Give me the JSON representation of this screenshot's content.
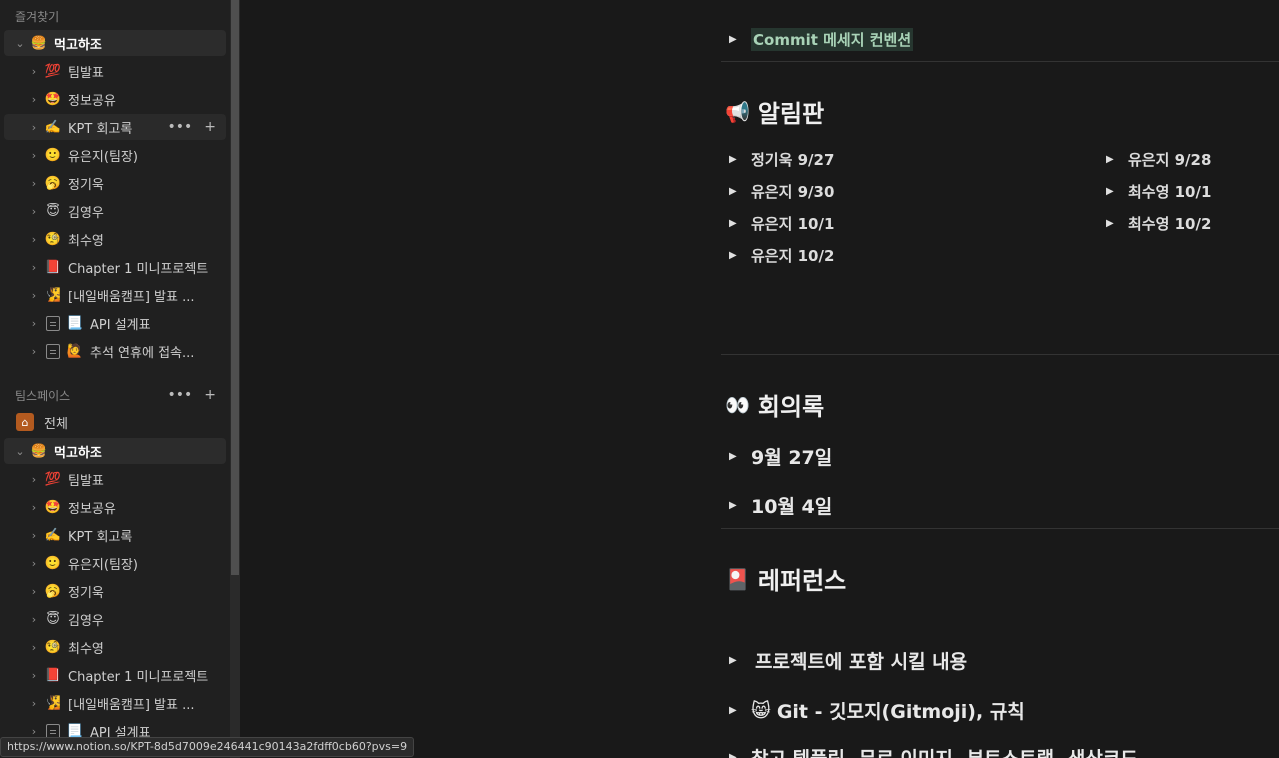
{
  "sidebar": {
    "favorites_label": "즐겨찾기",
    "favorites_root": {
      "label": "먹고하조",
      "icon": "🍔"
    },
    "favorites_items": [
      {
        "label": "팀발표",
        "icon": "💯"
      },
      {
        "label": "정보공유",
        "icon": "🤩"
      },
      {
        "label": "KPT 회고록",
        "icon": "✍️"
      },
      {
        "label": "유은지(팀장)",
        "icon": "🙂"
      },
      {
        "label": "정기욱",
        "icon": "🥱"
      },
      {
        "label": "김영우",
        "icon": "😇"
      },
      {
        "label": "최수영",
        "icon": "🧐"
      },
      {
        "label": "Chapter 1 미니프로젝트",
        "icon": "📕"
      },
      {
        "label": "[내일배움캠프] 발표 ...",
        "icon": "🧏"
      },
      {
        "label": "API 설계표",
        "icon": "📃"
      },
      {
        "label": "추석 연휴에 접속...",
        "icon": "🙋"
      }
    ],
    "teamspace_label": "팀스페이스",
    "all_label": "전체",
    "teamspace_root": {
      "label": "먹고하조",
      "icon": "🍔"
    },
    "teamspace_items": [
      {
        "label": "팀발표",
        "icon": "💯"
      },
      {
        "label": "정보공유",
        "icon": "🤩"
      },
      {
        "label": "KPT 회고록",
        "icon": "✍️"
      },
      {
        "label": "유은지(팀장)",
        "icon": "🙂"
      },
      {
        "label": "정기욱",
        "icon": "🥱"
      },
      {
        "label": "김영우",
        "icon": "😇"
      },
      {
        "label": "최수영",
        "icon": "🧐"
      },
      {
        "label": "Chapter 1 미니프로젝트",
        "icon": "📕"
      },
      {
        "label": "[내일배움캠프] 발표 ...",
        "icon": "🧏"
      },
      {
        "label": "API 설계표",
        "icon": "📃"
      }
    ],
    "more_glyph": "•••",
    "add_glyph": "+"
  },
  "status_url": "https://www.notion.so/KPT-8d5d7009e246441c90143a2fdff0cb60?pvs=9",
  "main": {
    "commit_toggle": "Commit 메세지 컨벤션",
    "notice": {
      "title": "알림판",
      "icon": "📢",
      "left": [
        "정기욱 9/27",
        "유은지 9/30",
        "유은지 10/1",
        "유은지 10/2"
      ],
      "right": [
        "유은지 9/28",
        "최수영 10/1",
        "최수영 10/2"
      ]
    },
    "minutes": {
      "title": "회의록",
      "icon": "👀",
      "items": [
        "9월 27일",
        "10월 4일"
      ]
    },
    "reference": {
      "title": "레퍼런스",
      "icon": "🎴",
      "items": [
        {
          "label": "프로젝트에 포함 시킬 내용",
          "icon": ""
        },
        {
          "label": "Git - 깃모지(Gitmoji), 규칙",
          "icon": "😸"
        },
        {
          "label": "참고 템플릿, 무료 이미지, 부트스트랩, 색상코드",
          "icon": ""
        }
      ]
    },
    "triangle": "▶"
  }
}
